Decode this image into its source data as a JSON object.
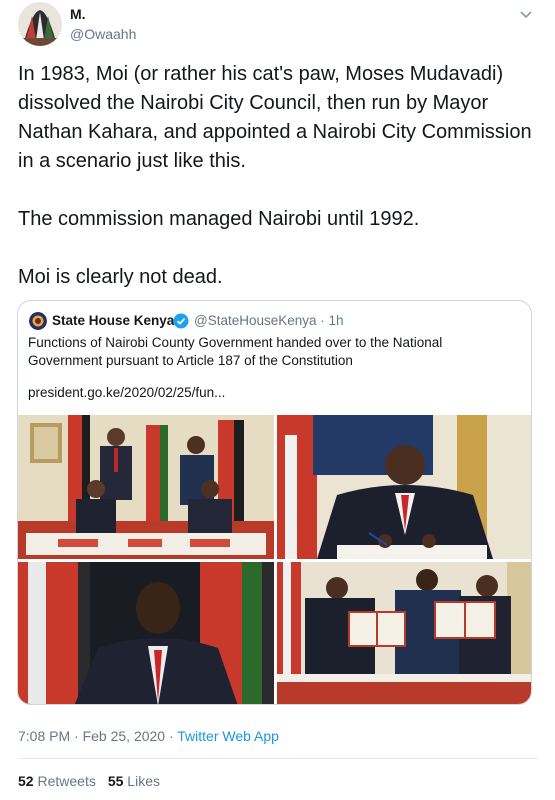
{
  "author": {
    "display_name": "M.",
    "handle": "@Owaahh",
    "avatar_icon": "avatar-image"
  },
  "tweet": {
    "paragraphs": [
      "In 1983, Moi (or rather his cat's paw, Moses Mudavadi) dissolved the Nairobi City Council, then run by Mayor Nathan Kahara, and appointed a Nairobi City Commission in a scenario just like this.",
      "The commission managed Nairobi until 1992.",
      "Moi is clearly not dead."
    ]
  },
  "quote": {
    "name": "State House Kenya",
    "handle_time": "@StateHouseKenya · 1h",
    "verified_icon": "verified-badge-icon",
    "text": "Functions of Nairobi County Government handed over to the National Government pursuant to Article 187 of the Constitution",
    "link": "president.go.ke/2020/02/25/fun..."
  },
  "meta": {
    "time": "7:08 PM · Feb 25, 2020 · ",
    "app": "Twitter Web App"
  },
  "stats": {
    "retweets_count": "52",
    "retweets_label": "Retweets",
    "likes_count": "55",
    "likes_label": "Likes"
  },
  "colors": {
    "link_blue": "#1b95e0",
    "secondary_text": "#657786",
    "border": "#ccd6dd"
  }
}
